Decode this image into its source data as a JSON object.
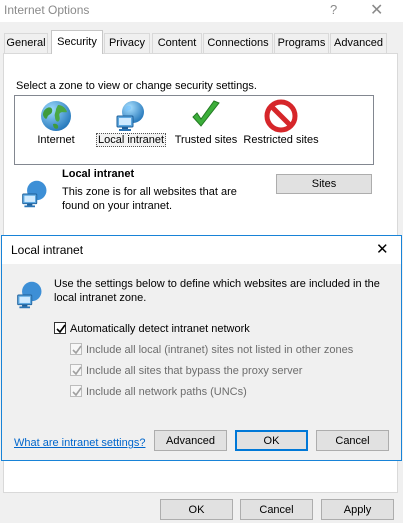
{
  "window": {
    "title": "Internet Options",
    "help_glyph": "?",
    "close_glyph": "✕"
  },
  "tabs": [
    {
      "label": "General"
    },
    {
      "label": "Security"
    },
    {
      "label": "Privacy"
    },
    {
      "label": "Content"
    },
    {
      "label": "Connections"
    },
    {
      "label": "Programs"
    },
    {
      "label": "Advanced"
    }
  ],
  "active_tab": "Security",
  "security": {
    "zone_prompt": "Select a zone to view or change security settings.",
    "zones": [
      {
        "label": "Internet",
        "icon": "globe-icon"
      },
      {
        "label": "Local intranet",
        "icon": "intranet-icon"
      },
      {
        "label": "Trusted sites",
        "icon": "checkmark-icon"
      },
      {
        "label": "Restricted sites",
        "icon": "restricted-icon"
      }
    ],
    "selected_zone": "Local intranet",
    "zone_title": "Local intranet",
    "zone_description": "This zone is for all websites that are found on your intranet.",
    "sites_button": "Sites"
  },
  "dialog": {
    "title": "Local intranet",
    "close_glyph": "✕",
    "description": "Use the settings below to define which websites are included in the local intranet zone.",
    "checkboxes": [
      {
        "label": "Automatically detect intranet network",
        "checked": true,
        "enabled": true
      },
      {
        "label": "Include all local (intranet) sites not listed in other zones",
        "checked": true,
        "enabled": false
      },
      {
        "label": "Include all sites that bypass the proxy server",
        "checked": true,
        "enabled": false
      },
      {
        "label": "Include all network paths (UNCs)",
        "checked": true,
        "enabled": false
      }
    ],
    "help_link": "What are intranet settings?",
    "advanced_button": "Advanced",
    "ok_button": "OK",
    "cancel_button": "Cancel"
  },
  "footer": {
    "ok_button": "OK",
    "cancel_button": "Cancel",
    "apply_button": "Apply"
  },
  "colors": {
    "accent": "#0078d7",
    "link": "#0066cc",
    "restricted": "#d6262a",
    "trusted": "#3cae3a"
  }
}
